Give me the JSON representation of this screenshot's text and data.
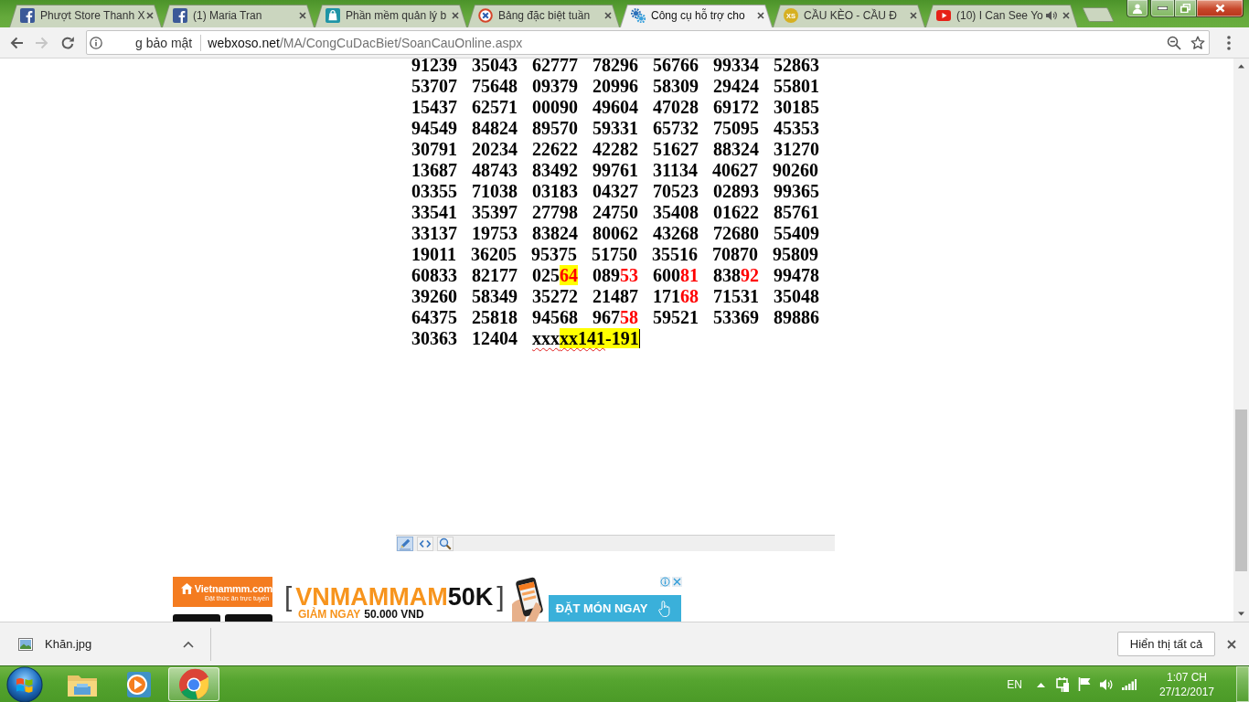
{
  "browser": {
    "tabs": [
      {
        "kind": "social",
        "title": "Phượt Store Thanh X",
        "selected": false,
        "audio": false
      },
      {
        "kind": "social",
        "title": "(1) Maria Tran",
        "selected": false,
        "audio": false
      },
      {
        "kind": "shop",
        "title": "Phần mềm quản lý b",
        "selected": false,
        "audio": false
      },
      {
        "kind": "target",
        "title": "Bảng đặc biệt tuần",
        "selected": false,
        "audio": false
      },
      {
        "kind": "gears",
        "title": "Công cụ hỗ trợ cho",
        "selected": true,
        "audio": false
      },
      {
        "kind": "badge",
        "badge": "XS",
        "title": "CẦU KÈO - CẦU Đ",
        "selected": false,
        "audio": false
      },
      {
        "kind": "video",
        "title": "(10) I Can See Yo",
        "selected": false,
        "audio": true
      }
    ],
    "nav": [
      {
        "kind": "back",
        "disabled": false
      },
      {
        "kind": "forward",
        "disabled": true
      },
      {
        "kind": "reload",
        "disabled": false
      }
    ],
    "address_bar": {
      "security_label": "g bảo mật",
      "host": "webxoso.net",
      "path": "/MA/CongCuDacBiet/SoanCauOnline.aspx"
    }
  },
  "editor": {
    "rows": [
      [
        {
          "kind": "plain",
          "text": "91239"
        },
        {
          "kind": "plain",
          "text": "35043"
        },
        {
          "kind": "plain",
          "text": "62777"
        },
        {
          "kind": "plain",
          "text": "78296"
        },
        {
          "kind": "plain",
          "text": "56766"
        },
        {
          "kind": "plain",
          "text": "99334"
        },
        {
          "kind": "plain",
          "text": "52863"
        }
      ],
      [
        {
          "kind": "plain",
          "text": "53707"
        },
        {
          "kind": "plain",
          "text": "75648"
        },
        {
          "kind": "plain",
          "text": "09379"
        },
        {
          "kind": "plain",
          "text": "20996"
        },
        {
          "kind": "plain",
          "text": "58309"
        },
        {
          "kind": "plain",
          "text": "29424"
        },
        {
          "kind": "plain",
          "text": "55801"
        }
      ],
      [
        {
          "kind": "plain",
          "text": "15437"
        },
        {
          "kind": "plain",
          "text": "62571"
        },
        {
          "kind": "plain",
          "text": "00090"
        },
        {
          "kind": "plain",
          "text": "49604"
        },
        {
          "kind": "plain",
          "text": "47028"
        },
        {
          "kind": "plain",
          "text": "69172"
        },
        {
          "kind": "plain",
          "text": "30185"
        }
      ],
      [
        {
          "kind": "plain",
          "text": "94549"
        },
        {
          "kind": "plain",
          "text": "84824"
        },
        {
          "kind": "plain",
          "text": "89570"
        },
        {
          "kind": "plain",
          "text": "59331"
        },
        {
          "kind": "plain",
          "text": "65732"
        },
        {
          "kind": "plain",
          "text": "75095"
        },
        {
          "kind": "plain",
          "text": "45353"
        }
      ],
      [
        {
          "kind": "plain",
          "text": "30791"
        },
        {
          "kind": "plain",
          "text": "20234"
        },
        {
          "kind": "plain",
          "text": "22622"
        },
        {
          "kind": "plain",
          "text": "42282"
        },
        {
          "kind": "plain",
          "text": "51627"
        },
        {
          "kind": "plain",
          "text": "88324"
        },
        {
          "kind": "plain",
          "text": "31270"
        }
      ],
      [
        {
          "kind": "plain",
          "text": "13687"
        },
        {
          "kind": "plain",
          "text": "48743"
        },
        {
          "kind": "plain",
          "text": "83492"
        },
        {
          "kind": "plain",
          "text": "99761"
        },
        {
          "kind": "plain",
          "text": "31134"
        },
        {
          "kind": "plain",
          "text": "40627"
        },
        {
          "kind": "plain",
          "text": "90260"
        }
      ],
      [
        {
          "kind": "plain",
          "text": "03355"
        },
        {
          "kind": "plain",
          "text": "71038"
        },
        {
          "kind": "plain",
          "text": "03183"
        },
        {
          "kind": "plain",
          "text": "04327"
        },
        {
          "kind": "plain",
          "text": "70523"
        },
        {
          "kind": "plain",
          "text": "02893"
        },
        {
          "kind": "plain",
          "text": "99365"
        }
      ],
      [
        {
          "kind": "plain",
          "text": "33541"
        },
        {
          "kind": "plain",
          "text": "35397"
        },
        {
          "kind": "plain",
          "text": "27798"
        },
        {
          "kind": "plain",
          "text": "24750"
        },
        {
          "kind": "plain",
          "text": "35408"
        },
        {
          "kind": "plain",
          "text": "01622"
        },
        {
          "kind": "plain",
          "text": "85761"
        }
      ],
      [
        {
          "kind": "plain",
          "text": "33137"
        },
        {
          "kind": "plain",
          "text": "19753"
        },
        {
          "kind": "plain",
          "text": "83824"
        },
        {
          "kind": "plain",
          "text": "80062"
        },
        {
          "kind": "plain",
          "text": "43268"
        },
        {
          "kind": "plain",
          "text": "72680"
        },
        {
          "kind": "plain",
          "text": "55409"
        }
      ],
      [
        {
          "kind": "plain",
          "text": "19011"
        },
        {
          "kind": "plain",
          "text": "36205"
        },
        {
          "kind": "plain",
          "text": "95375"
        },
        {
          "kind": "plain",
          "text": "51750"
        },
        {
          "kind": "plain",
          "text": "35516"
        },
        {
          "kind": "plain",
          "text": "70870"
        },
        {
          "kind": "plain",
          "text": "95809"
        }
      ],
      [
        {
          "kind": "plain",
          "text": "60833"
        },
        {
          "kind": "plain",
          "text": "82177"
        },
        {
          "kind": "parts",
          "parts": [
            {
              "text": "025",
              "matched": false,
              "highlighted": false,
              "misspelled": false
            },
            {
              "text": "64",
              "matched": true,
              "highlighted": true,
              "misspelled": false
            }
          ]
        },
        {
          "kind": "parts",
          "parts": [
            {
              "text": "089",
              "matched": false,
              "highlighted": false,
              "misspelled": false
            },
            {
              "text": "53",
              "matched": true,
              "highlighted": false,
              "misspelled": false
            }
          ]
        },
        {
          "kind": "parts",
          "parts": [
            {
              "text": "600",
              "matched": false,
              "highlighted": false,
              "misspelled": false
            },
            {
              "text": "81",
              "matched": true,
              "highlighted": false,
              "misspelled": false
            }
          ]
        },
        {
          "kind": "parts",
          "parts": [
            {
              "text": "838",
              "matched": false,
              "highlighted": false,
              "misspelled": false
            },
            {
              "text": "92",
              "matched": true,
              "highlighted": false,
              "misspelled": false
            }
          ]
        },
        {
          "kind": "plain",
          "text": "99478"
        }
      ],
      [
        {
          "kind": "plain",
          "text": "39260"
        },
        {
          "kind": "plain",
          "text": "58349"
        },
        {
          "kind": "plain",
          "text": "35272"
        },
        {
          "kind": "plain",
          "text": "21487"
        },
        {
          "kind": "parts",
          "parts": [
            {
              "text": "171",
              "matched": false,
              "highlighted": false,
              "misspelled": false
            },
            {
              "text": "68",
              "matched": true,
              "highlighted": false,
              "misspelled": false
            }
          ]
        },
        {
          "kind": "plain",
          "text": "71531"
        },
        {
          "kind": "plain",
          "text": "35048"
        }
      ],
      [
        {
          "kind": "plain",
          "text": "64375"
        },
        {
          "kind": "plain",
          "text": "25818"
        },
        {
          "kind": "plain",
          "text": "94568"
        },
        {
          "kind": "parts",
          "parts": [
            {
              "text": "967",
              "matched": false,
              "highlighted": false,
              "misspelled": false
            },
            {
              "text": "58",
              "matched": true,
              "highlighted": false,
              "misspelled": false
            }
          ]
        },
        {
          "kind": "plain",
          "text": "59521"
        },
        {
          "kind": "plain",
          "text": "53369"
        },
        {
          "kind": "plain",
          "text": "89886"
        }
      ],
      [
        {
          "kind": "plain",
          "text": "30363"
        },
        {
          "kind": "plain",
          "text": "12404"
        },
        {
          "kind": "parts",
          "parts": [
            {
              "text": "xxx",
              "matched": false,
              "highlighted": false,
              "misspelled": true
            },
            {
              "text": "xx141",
              "matched": false,
              "highlighted": true,
              "misspelled": true
            },
            {
              "text": "-191",
              "matched": false,
              "highlighted": true,
              "misspelled": false
            }
          ]
        }
      ]
    ],
    "caret": true,
    "modes": [
      {
        "kind": "design",
        "selected": true
      },
      {
        "kind": "html",
        "selected": false
      },
      {
        "kind": "preview",
        "selected": false
      }
    ]
  },
  "ad": {
    "brand": "Vietnammm.com",
    "tagline": "Đặt thức ăn trực tuyến",
    "bracket_open": "[",
    "code_name": "VNMAMMAM",
    "code_value": "50K",
    "bracket_close": "]",
    "offer_lead": "GIẢM NGAY",
    "offer_amount": "50.000 VND",
    "cta": "ĐẶT MÓN NGAY"
  },
  "downloads": {
    "items": [
      {
        "name": "Khăn.jpg"
      }
    ],
    "show_all": "Hiển thị tất cả"
  },
  "taskbar": {
    "apps": [
      {
        "kind": "files",
        "active": false
      },
      {
        "kind": "media",
        "active": false
      },
      {
        "kind": "browser",
        "active": true
      }
    ],
    "language": "EN",
    "time": "1:07 CH",
    "date": "27/12/2017"
  }
}
